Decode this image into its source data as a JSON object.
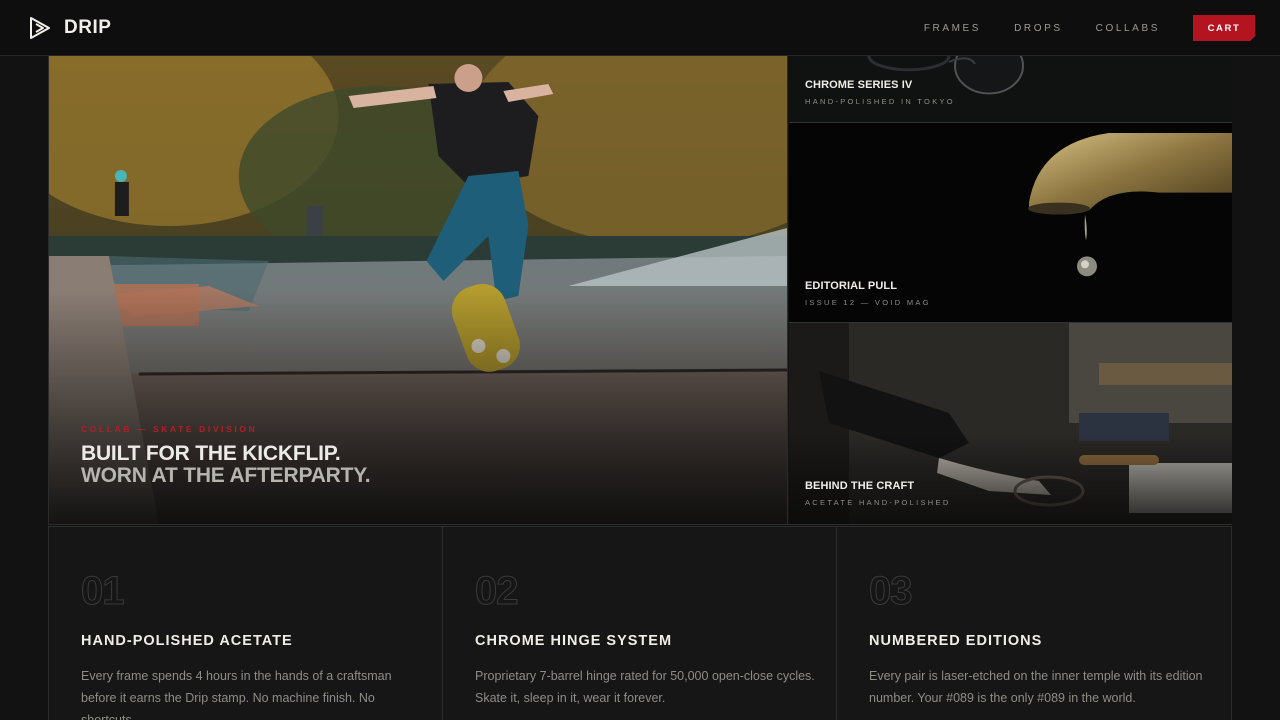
{
  "brand": {
    "name": "DRIP",
    "logo_icon": "play-triangle-icon"
  },
  "nav": {
    "items": [
      "FRAMES",
      "DROPS",
      "COLLABS"
    ],
    "cart_label": "CART",
    "cart_color": "#b3141f"
  },
  "hero": {
    "kicker": "COLLAB — SKATE DIVISION",
    "title_line1": "BUILT FOR THE KICKFLIP.",
    "title_line2": "WORN AT THE AFTERPARTY."
  },
  "tiles": [
    {
      "title": "CHROME SERIES IV",
      "subtitle": "HAND-POLISHED IN TOKYO"
    },
    {
      "title": "EDITORIAL PULL",
      "subtitle": "ISSUE 12 — VOID MAG"
    },
    {
      "title": "BEHIND THE CRAFT",
      "subtitle": "ACETATE HAND-POLISHED"
    }
  ],
  "features": [
    {
      "num": "01",
      "title": "HAND-POLISHED ACETATE",
      "body": "Every frame spends 4 hours in the hands of a craftsman before it earns the Drip stamp. No machine finish. No shortcuts."
    },
    {
      "num": "02",
      "title": "CHROME HINGE SYSTEM",
      "body": "Proprietary 7-barrel hinge rated for 50,000 open-close cycles. Skate it, sleep in it, wear it forever."
    },
    {
      "num": "03",
      "title": "NUMBERED EDITIONS",
      "body": "Every pair is laser-etched on the inner temple with its edition number. Your #089 is the only #089 in the world."
    }
  ],
  "accent_color": "#b31e26"
}
